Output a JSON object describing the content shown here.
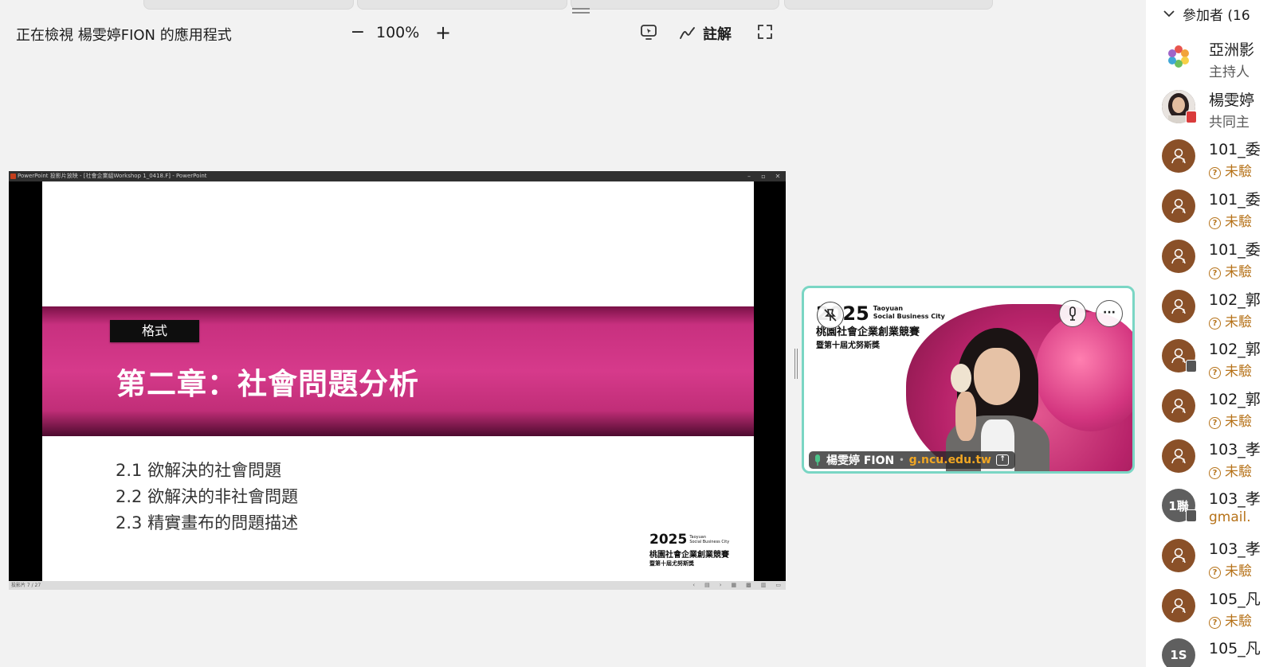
{
  "toolbar": {
    "viewing_label": "正在檢視 楊雯婷FION 的應用程式",
    "zoom_out": "−",
    "zoom_level": "100%",
    "zoom_in": "+",
    "annotate_label": "註解"
  },
  "shared_window": {
    "title": "PowerPoint 投影片放映 - [社會企業組Workshop 1_0418.F] - PowerPoint",
    "window_controls": [
      "–",
      "▫",
      "✕"
    ],
    "status_left": "投影片 7 / 27"
  },
  "slide": {
    "tag": "格式",
    "title": "第二章：社會問題分析",
    "items": [
      "2.1 欲解決的社會問題",
      "2.2 欲解決的非社會問題",
      "2.3 精實畫布的問題描述"
    ],
    "logo": {
      "year": "2025",
      "en_line1": "Taoyuan",
      "en_line2": "Social Business City",
      "zh_line1": "桃園社會企業創業競賽",
      "zh_line2": "暨第十屆尤努斯獎"
    }
  },
  "video": {
    "logo_year": "2025",
    "logo_en_line1": "Taoyuan",
    "logo_en_line2": "Social Business City",
    "logo_zh_line1": "桃園社會企業創業競賽",
    "logo_zh_line2": "暨第十屆尤努斯獎",
    "name": "楊雯婷 FION",
    "separator": "•",
    "domain": "g.ncu.edu.tw",
    "more_label": "···",
    "accent_color": "#7ad6c4"
  },
  "participants": {
    "header": "參加者 (16",
    "list": [
      {
        "name": "亞洲影",
        "sub": "主持人",
        "avatar_text": "",
        "kind": "logo"
      },
      {
        "name": "楊雯婷",
        "sub": "共同主",
        "avatar_text": "",
        "kind": "photo"
      },
      {
        "name": "101_委",
        "sub": "未驗",
        "avatar_text": "",
        "kind": "guest"
      },
      {
        "name": "101_委",
        "sub": "未驗",
        "avatar_text": "",
        "kind": "guest"
      },
      {
        "name": "101_委",
        "sub": "未驗",
        "avatar_text": "",
        "kind": "guest"
      },
      {
        "name": "102_郭",
        "sub": "未驗",
        "avatar_text": "",
        "kind": "guest"
      },
      {
        "name": "102_郭",
        "sub": "未驗",
        "avatar_text": "",
        "kind": "guest-badge"
      },
      {
        "name": "102_郭",
        "sub": "未驗",
        "avatar_text": "",
        "kind": "guest"
      },
      {
        "name": "103_孝",
        "sub": "未驗",
        "avatar_text": "",
        "kind": "guest"
      },
      {
        "name": "103_孝",
        "sub": "gmail.",
        "avatar_text": "1聯",
        "kind": "initials"
      },
      {
        "name": "103_孝",
        "sub": "未驗",
        "avatar_text": "",
        "kind": "guest"
      },
      {
        "name": "105_凡",
        "sub": "未驗",
        "avatar_text": "",
        "kind": "guest"
      },
      {
        "name": "105_凡",
        "sub": "",
        "avatar_text": "1S",
        "kind": "initials"
      }
    ]
  },
  "colors": {
    "slide_band": "#d63a8b",
    "guest_avatar": "#8a5028",
    "warning_text": "#b67219"
  }
}
